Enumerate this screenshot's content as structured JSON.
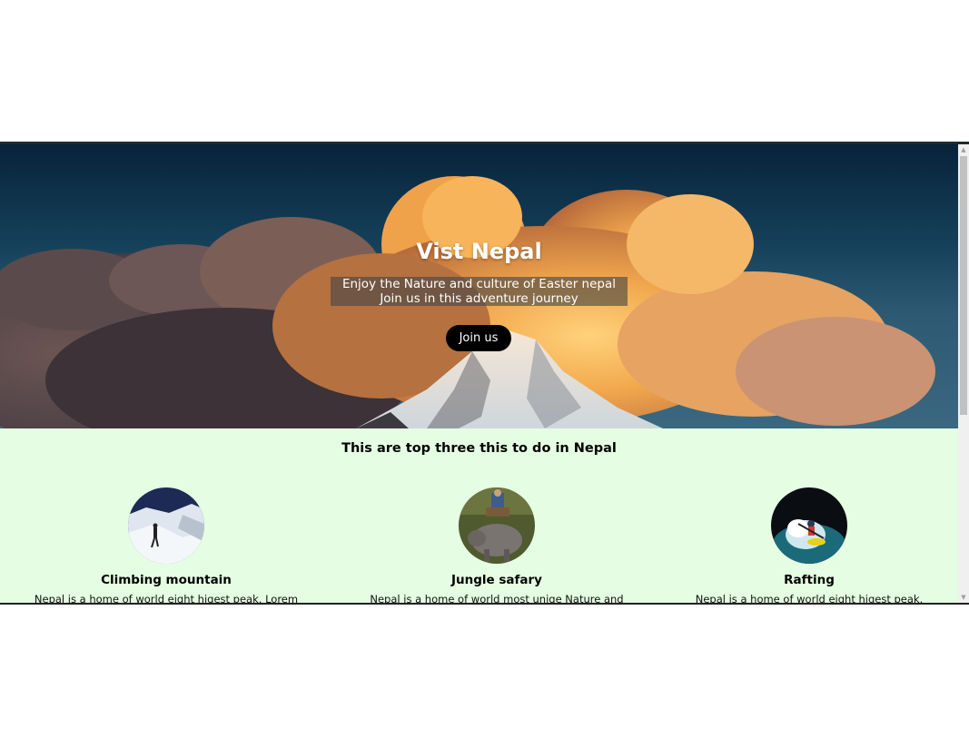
{
  "hero": {
    "title": "Vist Nepal",
    "subtitle_line1": "Enjoy the Nature and culture of Easter nepal",
    "subtitle_line2": "Join us in this adventure journey",
    "button_label": "Join us"
  },
  "section": {
    "title": "This are top three this to do in Nepal"
  },
  "cards": [
    {
      "title": "Climbing mountain",
      "text": "Nepal is a home of world eight higest peak. Lorem"
    },
    {
      "title": "Jungle safary",
      "text": "Nepal is a home of world most uniqe Nature and"
    },
    {
      "title": "Rafting",
      "text": "Nepal is a home of world eight higest peak."
    }
  ],
  "scrollbar": {
    "up_arrow": "▲",
    "down_arrow": "▼"
  }
}
